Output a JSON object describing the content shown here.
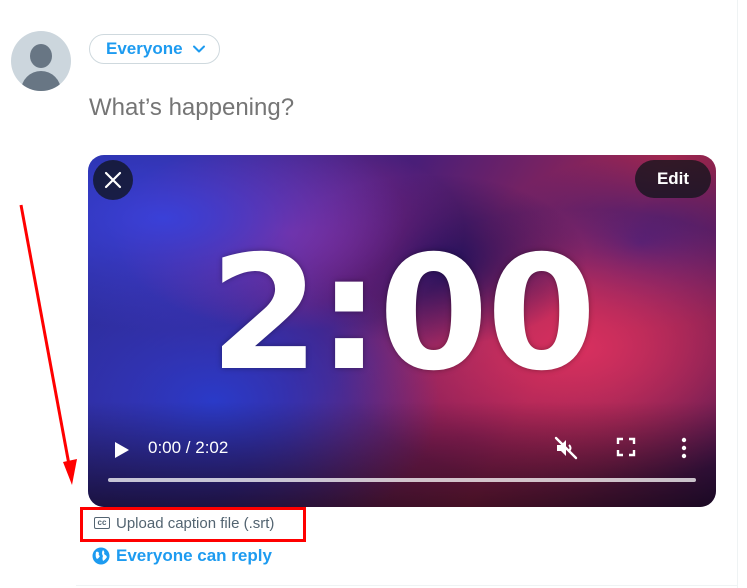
{
  "composer": {
    "audience_label": "Everyone",
    "placeholder": "What’s happening?"
  },
  "media": {
    "overlay_text": "2:00",
    "edit_label": "Edit",
    "time_display": "0:00 / 2:02",
    "progress": 0,
    "muted": true
  },
  "caption": {
    "label": "Upload caption file (.srt)",
    "icon_text": "cc"
  },
  "reply": {
    "label": "Everyone can reply"
  },
  "colors": {
    "accent": "#1d9bf0",
    "annotation": "#ff0000",
    "muted_text": "#536471"
  },
  "icons": {
    "avatar": "default-avatar-icon",
    "audience": "chevron-down-icon",
    "close": "close-icon",
    "play": "play-icon",
    "mute": "volume-muted-icon",
    "fullscreen": "fullscreen-icon",
    "more": "more-vertical-icon",
    "caption": "closed-caption-icon",
    "reply": "globe-icon"
  }
}
